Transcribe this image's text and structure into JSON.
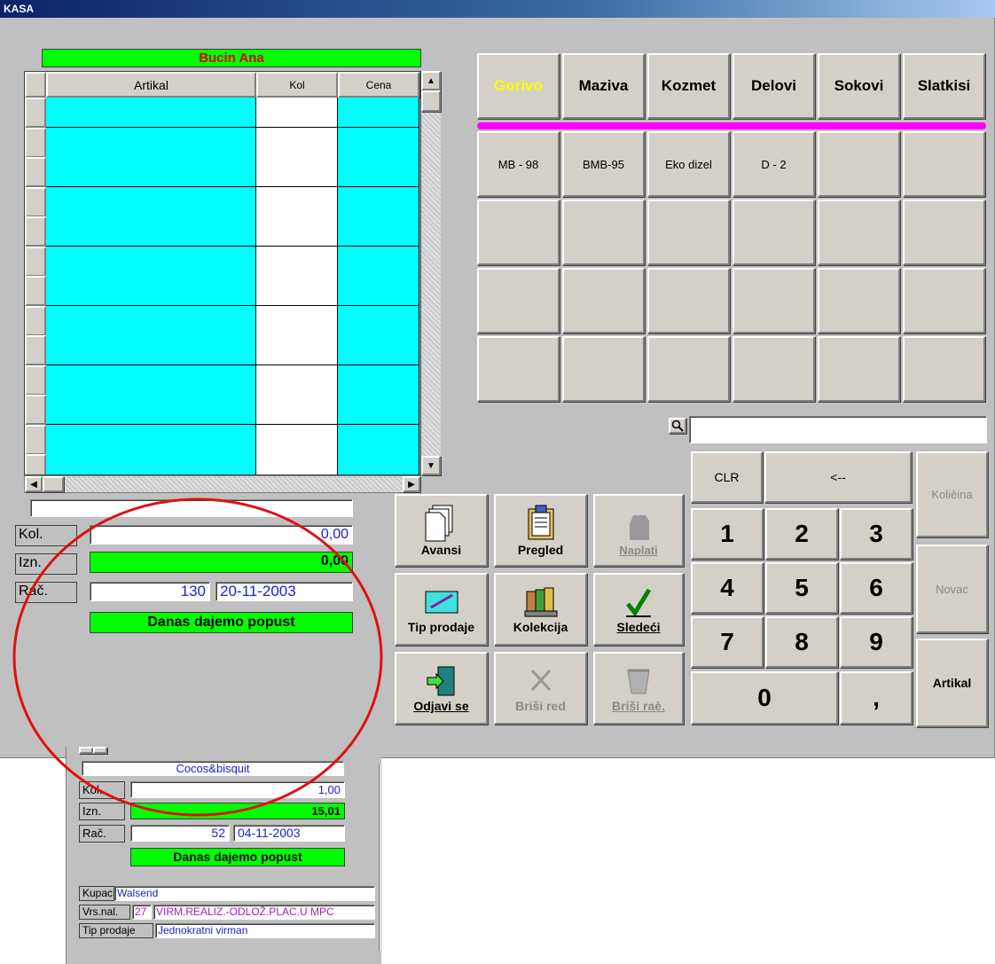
{
  "window": {
    "title": "KASA"
  },
  "cashier": {
    "name": "Bucin Ana"
  },
  "grid": {
    "headers": [
      "Artikal",
      "Kol",
      "Cena"
    ],
    "row_count": 13
  },
  "summary": {
    "item_name": "",
    "kol_label": "Kol.",
    "kol_value": "0,00",
    "izn_label": "Izn.",
    "izn_value": "0,00",
    "rac_label": "Rač.",
    "rac_number": "130",
    "rac_date": "20-11-2003",
    "promo": "Danas dajemo popust"
  },
  "categories": [
    {
      "label": "Gorivo",
      "color": "#ffff00"
    },
    {
      "label": "Maziva"
    },
    {
      "label": "Kozmet"
    },
    {
      "label": "Delovi"
    },
    {
      "label": "Sokovi"
    },
    {
      "label": "Slatkisi"
    }
  ],
  "products": [
    "MB - 98",
    "BMB-95",
    "Eko dizel",
    "D - 2"
  ],
  "search": {
    "value": ""
  },
  "actions": {
    "avansi": "Avansi",
    "pregled": "Pregled",
    "naplati": "Naplati",
    "tip_prodaje": "Tip prodaje",
    "kolekcija": "Kolekcija",
    "sledeci": "Sledeći",
    "odjavi_se": "Odjavi se",
    "brisi_red": "Briši red",
    "brisi_rac": "Briši raè."
  },
  "keypad": {
    "clr": "CLR",
    "back": "<--",
    "keys": [
      "1",
      "2",
      "3",
      "4",
      "5",
      "6",
      "7",
      "8",
      "9"
    ],
    "zero": "0",
    "comma": ",",
    "kolicina": "Kolièina",
    "novac": "Novac",
    "artikal": "Artikal"
  },
  "inset": {
    "item_name": "Cocos&bisquit",
    "kol_label": "Kol.",
    "kol_value": "1,00",
    "izn_label": "Izn.",
    "izn_value": "15,01",
    "rac_label": "Rač.",
    "rac_number": "52",
    "rac_date": "04-11-2003",
    "promo": "Danas dajemo popust",
    "kupac_label": "Kupac",
    "kupac_value": "Walsend",
    "vrsnal_label": "Vrs.nal.",
    "vrsnal_code": "27",
    "vrsnal_value": "VIRM.REALIZ.-ODLOŽ.PLAC.U MPC",
    "tip_label": "Tip prodaje",
    "tip_value": "Jednokratni virman"
  },
  "colors": {
    "highlight_circle": "#e01010",
    "accent_bar": "#ff00ff",
    "green": "#00ff00",
    "cyan": "#00ffff"
  }
}
